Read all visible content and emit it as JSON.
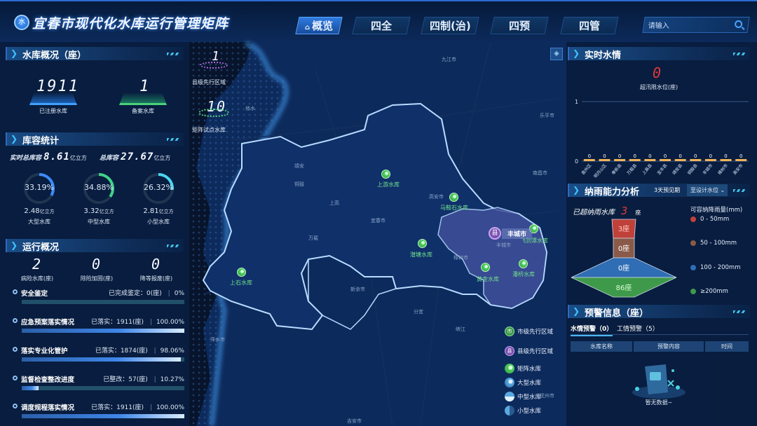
{
  "app": {
    "title": "宜春市现代化水库运行管理矩阵",
    "logo_text": "水"
  },
  "nav": {
    "tabs": [
      {
        "label": "概览",
        "active": true
      },
      {
        "label": "四全"
      },
      {
        "label": "四制(治)"
      },
      {
        "label": "四预"
      },
      {
        "label": "四管"
      }
    ],
    "search_placeholder": "请输入"
  },
  "overview": {
    "title": "水库概况（座）",
    "registered": {
      "value": "1911",
      "label": "已注册水库"
    },
    "filed": {
      "value": "1",
      "label": "备案水库"
    }
  },
  "capacity": {
    "title": "库容统计",
    "realtime_label": "实时总库容",
    "realtime_value": "8.61",
    "realtime_unit": "亿立方",
    "total_label": "总库容",
    "total_value": "27.67",
    "total_unit": "亿立方",
    "rings": [
      {
        "percent_text": "33.19%",
        "percent": 33.19,
        "value": "2.48",
        "unit": "亿立方",
        "label": "大型水库",
        "color": "#3d8bff"
      },
      {
        "percent_text": "34.88%",
        "percent": 34.88,
        "value": "3.32",
        "unit": "亿立方",
        "label": "中型水库",
        "color": "#3fd28a"
      },
      {
        "percent_text": "26.32%",
        "percent": 26.32,
        "value": "2.81",
        "unit": "亿立方",
        "label": "小型水库",
        "color": "#49d6f0"
      }
    ]
  },
  "operation": {
    "title": "运行概况",
    "stats": [
      {
        "value": "2",
        "label": "病险水库(座)"
      },
      {
        "value": "0",
        "label": "除险加固(座)"
      },
      {
        "value": "0",
        "label": "降等报废(座)"
      }
    ],
    "rows": [
      {
        "name": "安全鉴定",
        "detail": "已完成鉴定：0(座)",
        "sep": "|",
        "percent_text": "0%",
        "percent": 0
      },
      {
        "name": "应急预案落实情况",
        "detail": "已落实：1911(座)",
        "sep": "|",
        "percent_text": "100.00%",
        "percent": 100
      },
      {
        "name": "落实专业化管护",
        "detail": "已落实：1874(座)",
        "sep": "|",
        "percent_text": "98.06%",
        "percent": 98.06
      },
      {
        "name": "监督检查整改进度",
        "detail": "已整改：57(座)",
        "sep": "|",
        "percent_text": "10.27%",
        "percent": 10.27
      },
      {
        "name": "调度规程落实情况",
        "detail": "已落实：1911(座)",
        "sep": "|",
        "percent_text": "100.00%",
        "percent": 100
      }
    ]
  },
  "map": {
    "county_count": {
      "value": "1",
      "label": "县级先行区域"
    },
    "matrix_count": {
      "value": "10",
      "label": "矩阵试点水库"
    },
    "reservoirs": [
      "上游水库",
      "马鞍石水库",
      "飞剑潭水库",
      "潜塘水库",
      "上石水库",
      "黄金水库",
      "潘桥水库"
    ],
    "county_marker": {
      "icon": "县",
      "label": "丰城市"
    },
    "cities": [
      "九江市",
      "南昌市",
      "宜春市",
      "高安市",
      "樟树市",
      "新余市",
      "萍乡市",
      "吉安市",
      "靖安",
      "铜鼓",
      "修水",
      "万载",
      "上高",
      "分宜",
      "峡江",
      "抚州市",
      "乐平市",
      "丰城市"
    ],
    "legend": [
      {
        "label": "市级先行区域",
        "icon": "市"
      },
      {
        "label": "县级先行区域",
        "icon": "县"
      },
      {
        "label": "矩阵水库"
      },
      {
        "label": "大型水库"
      },
      {
        "label": "中型水库"
      },
      {
        "label": "小型水库"
      }
    ]
  },
  "water": {
    "title": "实时水情",
    "over_limit_value": "0",
    "over_limit_label": "超汛限水位(座)",
    "chart_data": {
      "type": "bar",
      "categories": [
        "袁州区",
        "明月山区",
        "奉新县",
        "万载县",
        "上高县",
        "宜丰县",
        "靖安县",
        "铜鼓县",
        "丰城市",
        "樟树市",
        "高安市"
      ],
      "values": [
        0,
        0,
        0,
        0,
        0,
        0,
        0,
        0,
        0,
        0,
        0
      ],
      "ylim": [
        0,
        1
      ],
      "yticks": [
        "0",
        "1"
      ],
      "bar_color": "#f0b45a"
    }
  },
  "rain": {
    "title": "纳雨能力分析",
    "forecast_label": "3天预见期",
    "dropdown": "至设计水位",
    "exceed_label": "已超纳雨水库",
    "exceed_value": "3",
    "exceed_unit": "座",
    "legend_title": "可容纳降雨量(mm)",
    "levels": [
      {
        "label": "0 - 50mm",
        "value": "3座",
        "color": "#c0403a"
      },
      {
        "label": "50 - 100mm",
        "value": "0座",
        "color": "#8a5a48"
      },
      {
        "label": "100 - 200mm",
        "value": "0座",
        "color": "#2f6db5"
      },
      {
        "label": "≥200mm",
        "value": "86座",
        "color": "#3e9a4a"
      }
    ]
  },
  "warning": {
    "title": "预警信息（座）",
    "tabs": [
      {
        "label": "水情预警（0）",
        "active": true
      },
      {
        "label": "工情预警（5）"
      }
    ],
    "columns": [
      "水库名称",
      "预警内容",
      "时间"
    ],
    "empty": "暂无数据~"
  }
}
